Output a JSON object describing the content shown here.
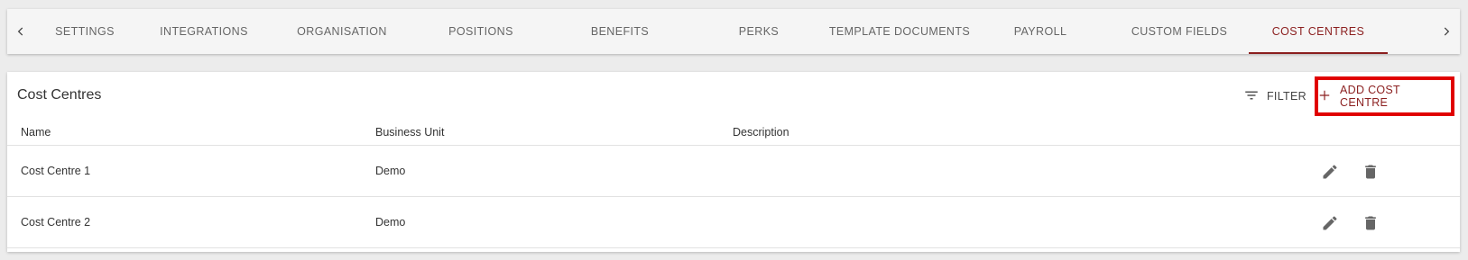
{
  "tabs": [
    {
      "label": "SETTINGS",
      "active": false
    },
    {
      "label": "INTEGRATIONS",
      "active": false
    },
    {
      "label": "ORGANISATION",
      "active": false
    },
    {
      "label": "POSITIONS",
      "active": false
    },
    {
      "label": "BENEFITS",
      "active": false
    },
    {
      "label": "PERKS",
      "active": false
    },
    {
      "label": "TEMPLATE DOCUMENTS",
      "active": false
    },
    {
      "label": "PAYROLL",
      "active": false
    },
    {
      "label": "CUSTOM FIELDS",
      "active": false
    },
    {
      "label": "COST CENTRES",
      "active": true
    }
  ],
  "card": {
    "title": "Cost Centres",
    "filter_label": "FILTER",
    "add_label": "ADD COST CENTRE"
  },
  "table": {
    "columns": [
      "Name",
      "Business Unit",
      "Description"
    ],
    "rows": [
      {
        "name": "Cost Centre 1",
        "business_unit": "Demo",
        "description": ""
      },
      {
        "name": "Cost Centre 2",
        "business_unit": "Demo",
        "description": ""
      }
    ]
  },
  "colors": {
    "accent": "#8b1f1f",
    "highlight_box": "#e00000",
    "background": "#ececec"
  },
  "icons": {
    "tab_prev": "chevron-left-icon",
    "tab_next": "chevron-right-icon",
    "filter": "filter-icon",
    "add": "plus-icon",
    "edit": "pencil-icon",
    "delete": "trash-icon"
  }
}
